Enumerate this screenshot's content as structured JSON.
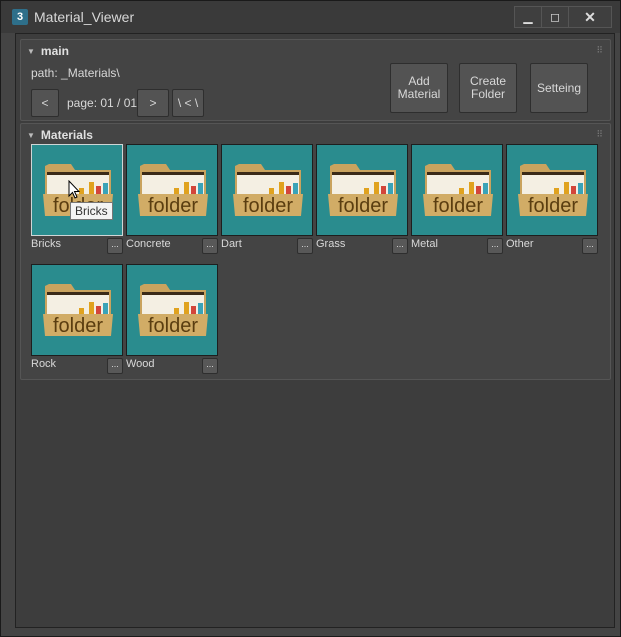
{
  "window": {
    "title": "Material_Viewer",
    "app_icon_glyph": "3",
    "minimize_glyph": "▁",
    "maximize_glyph": "◻",
    "close_glyph": "✕"
  },
  "main": {
    "heading": "main",
    "path_label": "path: _Materials\\",
    "prev_label": "<",
    "page_label": "page: 01 / 01",
    "next_label": ">",
    "root_label": "\\ < \\",
    "add_material_label": "Add Material",
    "create_folder_label": "Create Folder",
    "setting_label": "Setteing"
  },
  "materials": {
    "heading": "Materials",
    "folder_text": "folder",
    "more_label": "...",
    "items": [
      {
        "name": "Bricks"
      },
      {
        "name": "Concrete"
      },
      {
        "name": "Dart"
      },
      {
        "name": "Grass"
      },
      {
        "name": "Metal"
      },
      {
        "name": "Other"
      },
      {
        "name": "Rock"
      },
      {
        "name": "Wood"
      }
    ],
    "tooltip": "Bricks"
  },
  "colors": {
    "tile_bg": "#2a8c8e",
    "folder": "#c9a35e",
    "folder_text": "#5a3d10",
    "window_bg": "#444444"
  }
}
